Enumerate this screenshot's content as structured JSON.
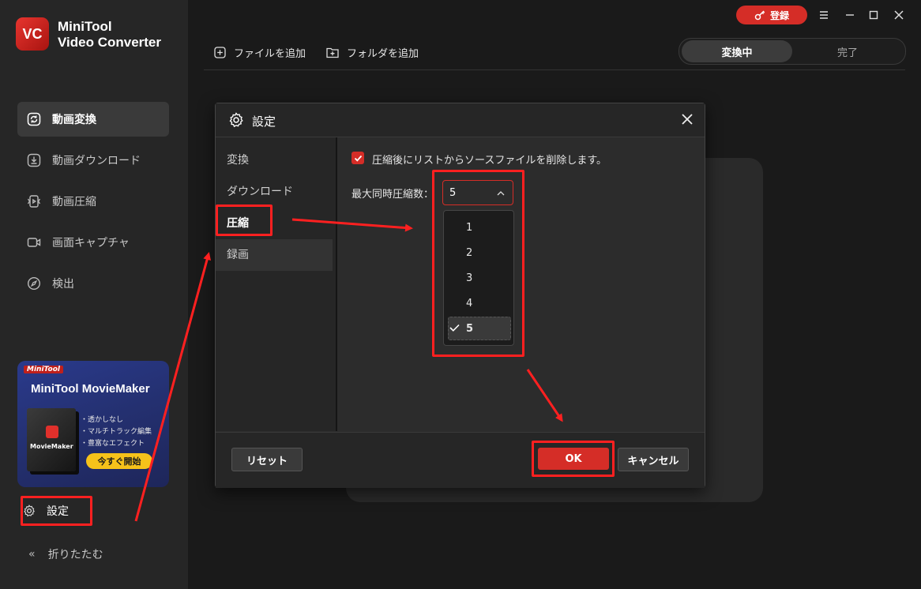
{
  "app": {
    "title_line1": "MiniTool",
    "title_line2": "Video Converter",
    "logo": "VC"
  },
  "sidebar": {
    "items": [
      {
        "label": "動画変換",
        "icon": "convert-icon",
        "active": true
      },
      {
        "label": "動画ダウンロード",
        "icon": "download-icon",
        "active": false
      },
      {
        "label": "動画圧縮",
        "icon": "compress-icon",
        "active": false
      },
      {
        "label": "画面キャプチャ",
        "icon": "camera-icon",
        "active": false
      },
      {
        "label": "検出",
        "icon": "compass-icon",
        "active": false
      }
    ],
    "promo": {
      "brand": "MiniTool",
      "title": "MiniTool MovieMaker",
      "box_name": "MovieMaker",
      "features": [
        "・透かしなし",
        "・マルチトラック編集",
        "・豊富なエフェクト"
      ],
      "cta": "今すぐ開始"
    },
    "settings_label": "設定",
    "collapse_label": "折りたたむ"
  },
  "toolbar": {
    "add_file": "ファイルを追加",
    "add_folder": "フォルダを追加"
  },
  "segment": {
    "converting": "変換中",
    "done": "完了"
  },
  "titlebar": {
    "register": "登録"
  },
  "dialog": {
    "title": "設定",
    "tabs": [
      "変換",
      "ダウンロード",
      "圧縮",
      "録画"
    ],
    "active_tab": "圧縮",
    "delete_source_label": "圧縮後にリストからソースファイルを削除します。",
    "delete_source_checked": true,
    "max_label": "最大同時圧縮数：",
    "max_value": "5",
    "options": [
      "1",
      "2",
      "3",
      "4",
      "5"
    ],
    "reset": "リセット",
    "ok": "OK",
    "cancel": "キャンセル"
  },
  "colors": {
    "accent": "#d52d27",
    "annotation": "#ff2020",
    "bg": "#1a1a1a",
    "sidebar": "#262626"
  }
}
